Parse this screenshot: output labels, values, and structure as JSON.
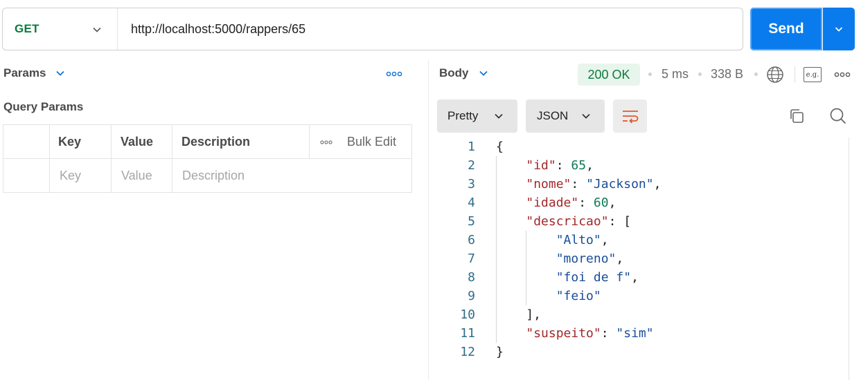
{
  "request": {
    "method": "GET",
    "url": "http://localhost:5000/rappers/65",
    "send_label": "Send"
  },
  "left": {
    "tab_label": "Params",
    "section_title": "Query Params",
    "table": {
      "headers": [
        "Key",
        "Value",
        "Description"
      ],
      "bulk_edit": "Bulk Edit",
      "placeholders": [
        "Key",
        "Value",
        "Description"
      ]
    }
  },
  "response": {
    "tab_label": "Body",
    "status": "200 OK",
    "time": "5 ms",
    "size": "338 B",
    "eg_label": "e.g.",
    "format": "Pretty",
    "language": "JSON",
    "line_numbers": [
      "1",
      "2",
      "3",
      "4",
      "5",
      "6",
      "7",
      "8",
      "9",
      "10",
      "11",
      "12"
    ],
    "json": {
      "id": 65,
      "nome": "Jackson",
      "idade": 60,
      "descricao": [
        "Alto",
        "moreno",
        "foi de f",
        "feio"
      ],
      "suspeito": "sim"
    },
    "keys": {
      "id": "\"id\"",
      "nome": "\"nome\"",
      "idade": "\"idade\"",
      "descricao": "\"descricao\"",
      "suspeito": "\"suspeito\""
    },
    "values": {
      "id": "65",
      "nome": "\"Jackson\"",
      "idade": "60",
      "descricao_items": [
        "\"Alto\"",
        "\"moreno\"",
        "\"foi de f\"",
        "\"feio\""
      ],
      "suspeito": "\"sim\""
    }
  },
  "colors": {
    "send": "#097bed",
    "method": "#0b7a3e",
    "status_bg": "#e8f5ec",
    "json_key": "#a3282b",
    "json_string": "#1a4d99",
    "json_number": "#117a57",
    "wrap_icon": "#e0572f"
  },
  "icons": [
    "chevron-down-icon",
    "more-dots-icon",
    "globe-icon",
    "example-icon",
    "wrap-lines-icon",
    "copy-icon",
    "search-icon"
  ]
}
